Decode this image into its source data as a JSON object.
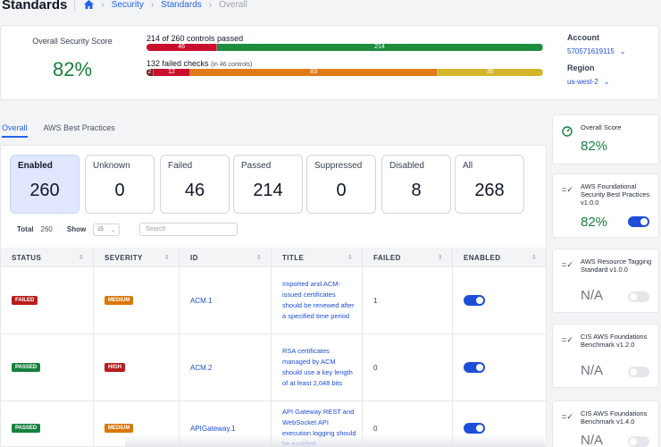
{
  "header": {
    "title": "Standards",
    "breadcrumb": [
      "Security",
      "Standards",
      "Overall"
    ]
  },
  "summary": {
    "score_label": "Overall Security Score",
    "score_value": "82%",
    "controls_title": "214 of 260 controls passed",
    "controls_segments": [
      {
        "label": "46",
        "value": 46,
        "color": "#c8102e"
      },
      {
        "label": "214",
        "value": 214,
        "color": "#1e8e3e"
      }
    ],
    "checks_title": "132 failed checks",
    "checks_subtitle": "(in 46 controls)",
    "checks_segments": [
      {
        "label": "2",
        "value": 2,
        "color": "#7f1d1d"
      },
      {
        "label": "12",
        "value": 12,
        "color": "#c8102e"
      },
      {
        "label": "83",
        "value": 83,
        "color": "#e07b1a"
      },
      {
        "label": "35",
        "value": 35,
        "color": "#d4b62a"
      }
    ],
    "account_label": "Account",
    "account_value": "570571619115",
    "region_label": "Region",
    "region_value": "us-west-2"
  },
  "tabs": [
    "Overall",
    "AWS Best Practices"
  ],
  "counts": [
    {
      "label": "Enabled",
      "value": "260"
    },
    {
      "label": "Unknown",
      "value": "0"
    },
    {
      "label": "Failed",
      "value": "46"
    },
    {
      "label": "Passed",
      "value": "214"
    },
    {
      "label": "Suppressed",
      "value": "0"
    },
    {
      "label": "Disabled",
      "value": "8"
    },
    {
      "label": "All",
      "value": "268"
    }
  ],
  "controls": {
    "total_label": "Total",
    "total_value": "260",
    "show_label": "Show",
    "page_size": "25",
    "search_placeholder": "Search"
  },
  "table": {
    "columns": [
      "STATUS",
      "SEVERITY",
      "ID",
      "TITLE",
      "FAILED",
      "ENABLED"
    ],
    "rows": [
      {
        "status": "FAILED",
        "severity": "MEDIUM",
        "id": "ACM.1",
        "title": "Imported and ACM-issued certificates should be renewed after a specified time period",
        "failed": "1",
        "enabled": true
      },
      {
        "status": "PASSED",
        "severity": "HIGH",
        "id": "ACM.2",
        "title": "RSA certificates managed by ACM should use a key length of at least 2,048 bits",
        "failed": "0",
        "enabled": true
      },
      {
        "status": "PASSED",
        "severity": "MEDIUM",
        "id": "APIGateway.1",
        "title": "API Gateway REST and WebSocket API execution logging should be enabled",
        "failed": "0",
        "enabled": true
      }
    ]
  },
  "sidebar": [
    {
      "title": "Overall Score",
      "value": "82%",
      "toggle": null,
      "icon": "gauge-icon"
    },
    {
      "title": "AWS Foundational Security Best Practices v1.0.0",
      "value": "82%",
      "toggle": true,
      "icon": "checklist-icon"
    },
    {
      "title": "AWS Resource Tagging Standard v1.0.0",
      "value": "N/A",
      "toggle": false,
      "icon": "checklist-icon"
    },
    {
      "title": "CIS AWS Foundations Benchmark v1.2.0",
      "value": "N/A",
      "toggle": false,
      "icon": "checklist-icon"
    },
    {
      "title": "CIS AWS Foundations Benchmark v1.4.0",
      "value": "N/A",
      "toggle": false,
      "icon": "checklist-icon"
    }
  ]
}
